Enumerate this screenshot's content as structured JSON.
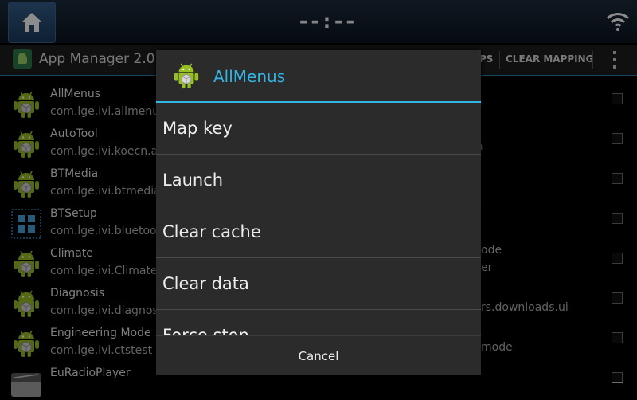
{
  "status_bar": {
    "clock": "--:--"
  },
  "action_bar": {
    "title": "App Manager 2.0.4",
    "actions_partial": "PS",
    "clear_mapping_label": "CLEAR MAPPING"
  },
  "apps": [
    {
      "name": "AllMenus",
      "package": "com.lge.ivi.allmenus",
      "icon": "android-icon"
    },
    {
      "name": "AutoTool",
      "package": "com.lge.ivi.koecn.a",
      "icon": "android-icon"
    },
    {
      "name": "BTMedia",
      "package": "com.lge.ivi.btmedia",
      "icon": "android-icon"
    },
    {
      "name": "BTSetup",
      "package": "com.lge.ivi.bluetoo",
      "icon": "grid-icon"
    },
    {
      "name": "Climate",
      "package": "com.lge.ivi.Climate",
      "icon": "android-icon"
    },
    {
      "name": "Diagnosis",
      "package": "com.lge.ivi.diagnos",
      "icon": "android-icon"
    },
    {
      "name": "Engineering Mode",
      "package": "com.lge.ivi.ctstest",
      "icon": "android-icon"
    },
    {
      "name": "EuRadioPlayer",
      "package": "",
      "icon": "radio-icon"
    }
  ],
  "right_column_peeks": [
    "a",
    "ode",
    "er",
    "rs.downloads.ui",
    "mode"
  ],
  "dialog": {
    "title": "AllMenus",
    "items": [
      "Map key",
      "Launch",
      "Clear cache",
      "Clear data",
      "Force stop"
    ],
    "cancel_label": "Cancel"
  },
  "colors": {
    "accent": "#33b5e5",
    "dialog_bg": "#2b2b2b",
    "android_green": "#97c024"
  }
}
